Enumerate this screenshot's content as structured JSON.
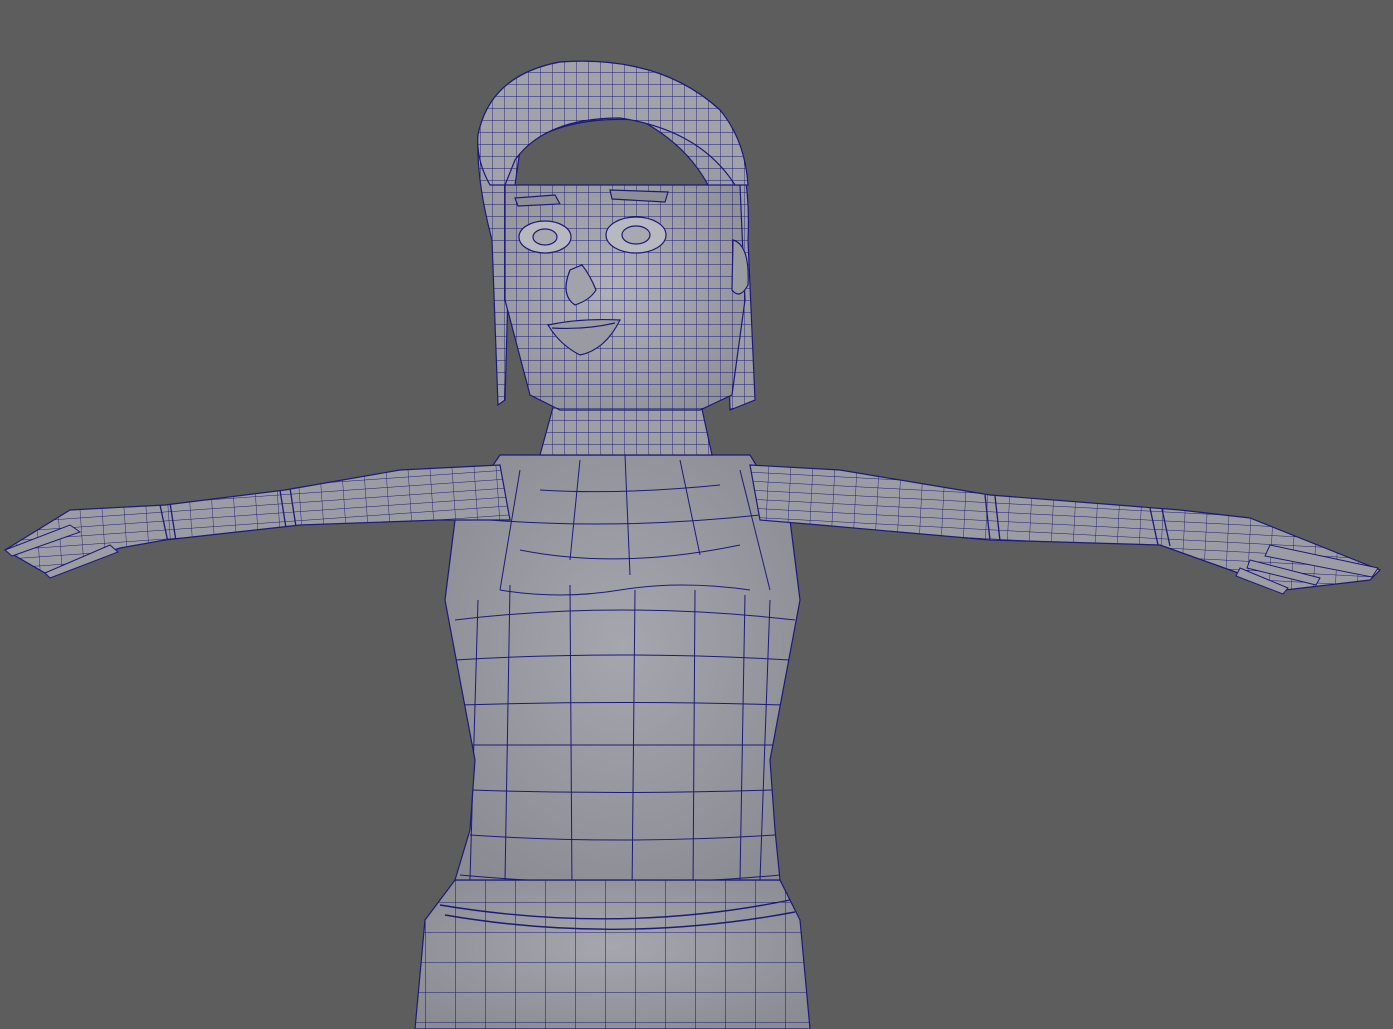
{
  "viewport": {
    "background": "#5d5d5d",
    "wire_color": "#1c1a78",
    "mesh_fill": "#9a9aa2",
    "mesh_shade": "#8a8a92",
    "mesh_light": "#a8a8b0",
    "display_mode": "wireframe-on-shaded",
    "subject": "character-mesh-t-pose"
  }
}
